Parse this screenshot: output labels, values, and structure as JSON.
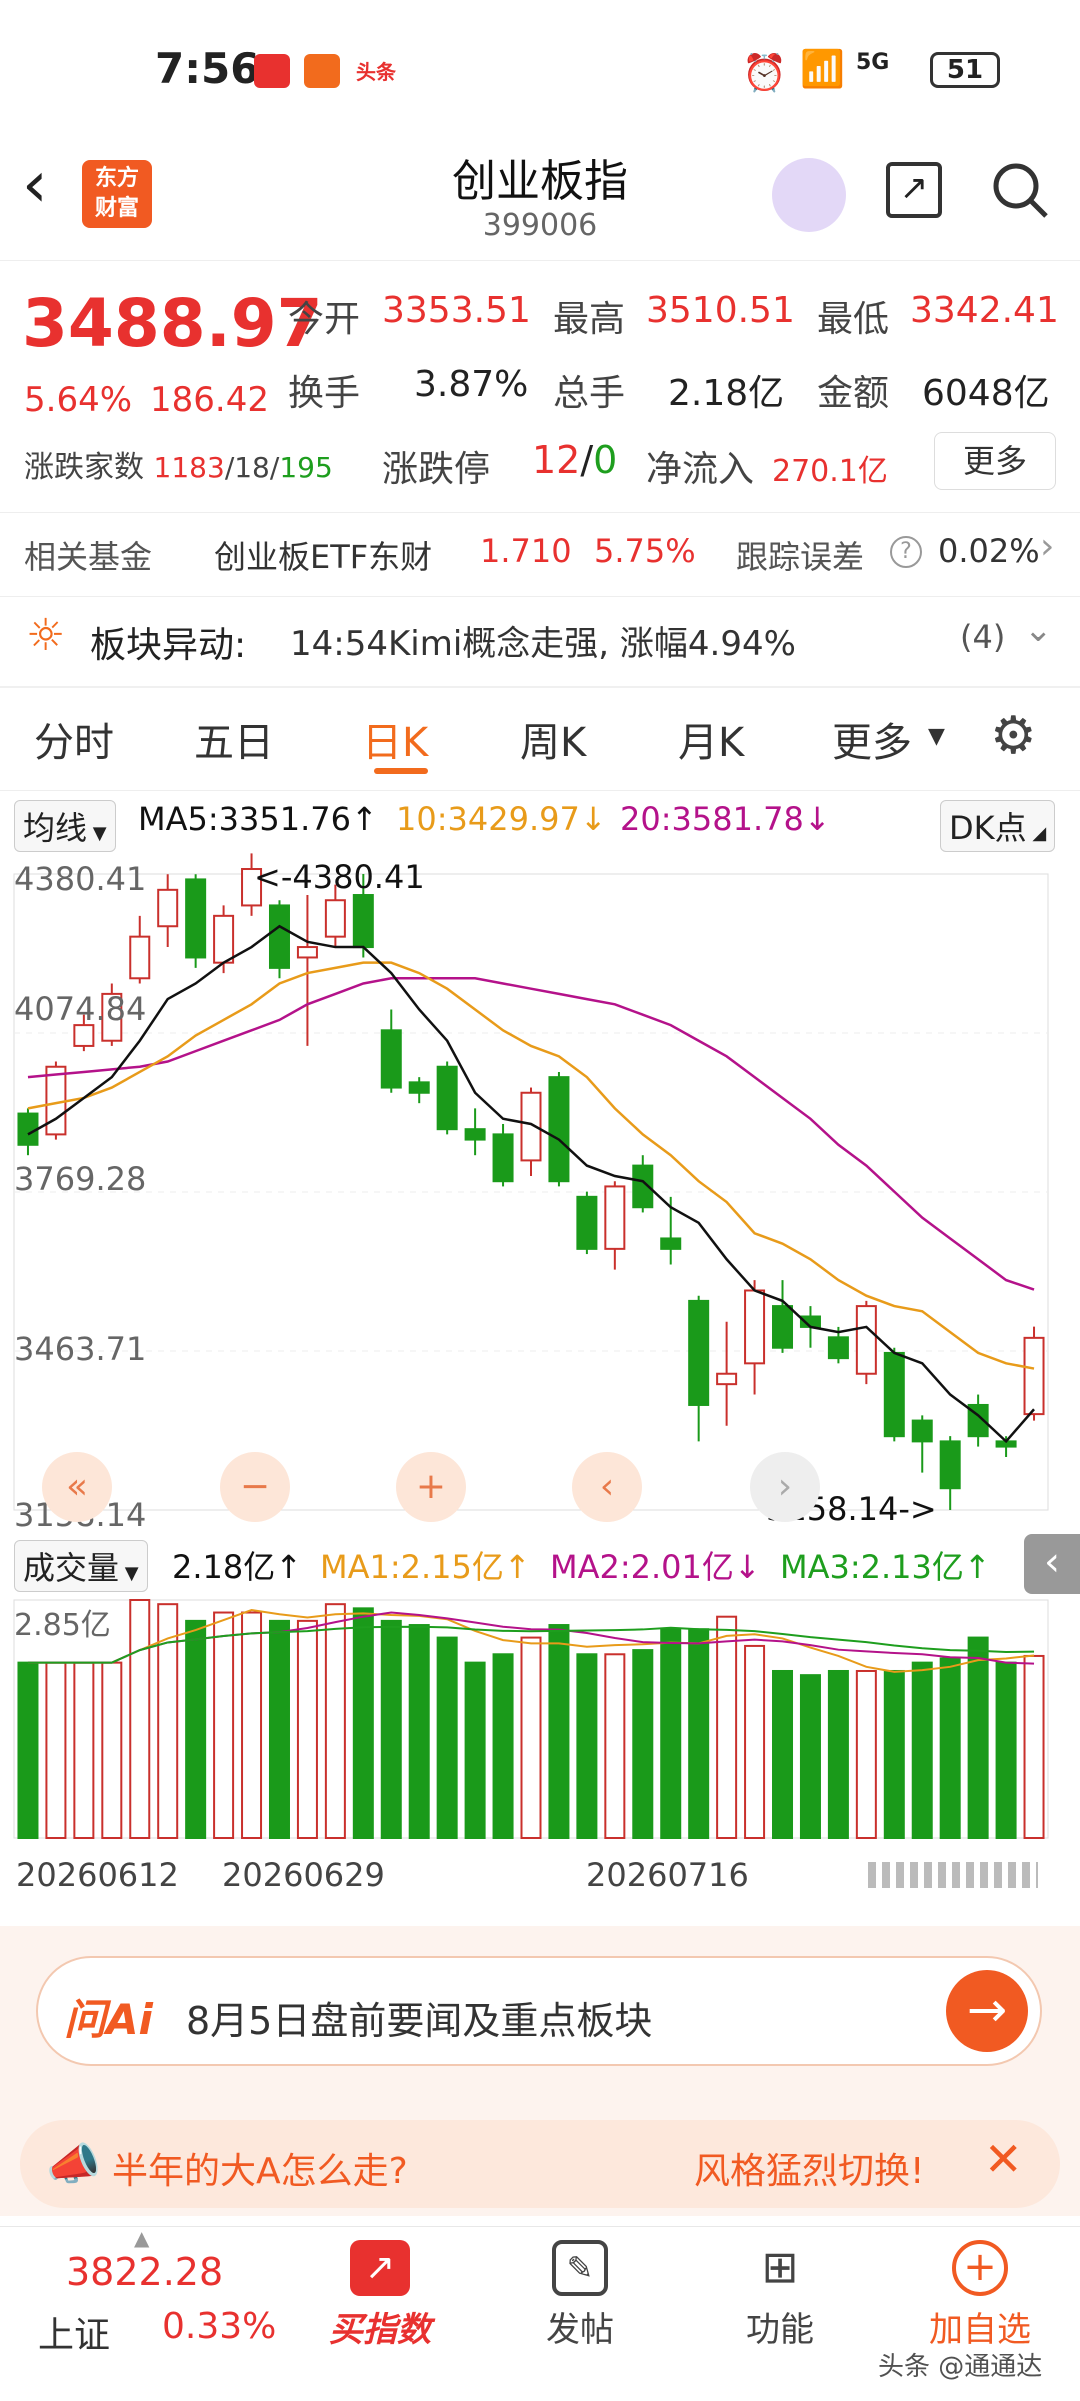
{
  "status_bar": {
    "time": "7:56",
    "notif_toutiao": "头条",
    "network": "5G",
    "battery": "51"
  },
  "header": {
    "logo_line1": "东方",
    "logo_line2": "财富",
    "title": "创业板指",
    "code": "399006"
  },
  "quote": {
    "price": "3488.97",
    "pct": "5.64%",
    "change": "186.42",
    "open_label": "今开",
    "open": "3353.51",
    "high_label": "最高",
    "high": "3510.51",
    "low_label": "最低",
    "low": "3342.41",
    "turnover_label": "换手",
    "turnover": "3.87%",
    "vol_label": "总手",
    "vol": "2.18亿",
    "amount_label": "金额",
    "amount": "6048亿",
    "breadth_label": "涨跌家数",
    "breadth_up": "1183",
    "breadth_flat": "/18/",
    "breadth_down": "195",
    "limit_label": "涨跌停",
    "limit_up": "12",
    "limit_sep": "/",
    "limit_down": "0",
    "netflow_label": "净流入",
    "netflow": "270.1亿",
    "more": "更多"
  },
  "fund": {
    "label": "相关基金",
    "name": "创业板ETF东财",
    "price": "1.710",
    "pct": "5.75%",
    "err_label": "跟踪误差",
    "err": "0.02%"
  },
  "alert": {
    "label": "板块异动:",
    "text": "14:54Kimi概念走强, 涨幅4.94%",
    "count": "(4)"
  },
  "tabs": [
    "分时",
    "五日",
    "日K",
    "周K",
    "月K",
    "更多"
  ],
  "ma": {
    "selector": "均线",
    "ma5": "MA5:3351.76↑",
    "ma10": "10:3429.97↓",
    "ma20": "20:3581.78↓",
    "dk": "DK点"
  },
  "price_axis": [
    "4380.41",
    "4074.84",
    "3769.28",
    "3463.71",
    "3158.14"
  ],
  "annotations": {
    "high": "<-4380.41",
    "low": "3158.14->"
  },
  "vol_header": {
    "selector": "成交量",
    "vol": "2.18亿↑",
    "ma1": "MA1:2.15亿↑",
    "ma2": "MA2:2.01亿↓",
    "ma3": "MA3:2.13亿↑",
    "axis_top": "2.85亿"
  },
  "date_axis": [
    "20260612",
    "20260629",
    "20260716"
  ],
  "ask": {
    "brand": "问Ai",
    "text": "8月5日盘前要闻及重点板块"
  },
  "notice": {
    "left": "半年的大A怎么走?",
    "right": "风格猛烈切换!"
  },
  "bottom_nav": {
    "index_value": "3822.28",
    "index_name": "上证",
    "index_pct": "0.33%",
    "buy": "买指数",
    "post": "发帖",
    "func": "功能",
    "watch": "加自选",
    "watermark": "头条 @通通达"
  },
  "chart_data": {
    "type": "candlestick",
    "ylim": [
      3158.14,
      4380.41
    ],
    "candles": [
      {
        "o": 3920,
        "c": 3860,
        "h": 3930,
        "l": 3840
      },
      {
        "o": 3880,
        "c": 4010,
        "h": 4020,
        "l": 3870
      },
      {
        "o": 4050,
        "c": 4090,
        "h": 4110,
        "l": 4040
      },
      {
        "o": 4060,
        "c": 4150,
        "h": 4170,
        "l": 4050
      },
      {
        "o": 4180,
        "c": 4260,
        "h": 4300,
        "l": 4170
      },
      {
        "o": 4280,
        "c": 4350,
        "h": 4380,
        "l": 4240
      },
      {
        "o": 4370,
        "c": 4220,
        "h": 4380,
        "l": 4200
      },
      {
        "o": 4210,
        "c": 4300,
        "h": 4320,
        "l": 4190
      },
      {
        "o": 4320,
        "c": 4390,
        "h": 4420,
        "l": 4300
      },
      {
        "o": 4320,
        "c": 4200,
        "h": 4330,
        "l": 4180
      },
      {
        "o": 4220,
        "c": 4240,
        "h": 4340,
        "l": 4050
      },
      {
        "o": 4260,
        "c": 4330,
        "h": 4360,
        "l": 4240
      },
      {
        "o": 4340,
        "c": 4240,
        "h": 4380.41,
        "l": 4220
      },
      {
        "o": 4080,
        "c": 3970,
        "h": 4120,
        "l": 3960
      },
      {
        "o": 3980,
        "c": 3960,
        "h": 3990,
        "l": 3940
      },
      {
        "o": 4010,
        "c": 3890,
        "h": 4020,
        "l": 3880
      },
      {
        "o": 3890,
        "c": 3870,
        "h": 3930,
        "l": 3840
      },
      {
        "o": 3880,
        "c": 3790,
        "h": 3900,
        "l": 3780
      },
      {
        "o": 3830,
        "c": 3960,
        "h": 3970,
        "l": 3800
      },
      {
        "o": 3990,
        "c": 3790,
        "h": 4000,
        "l": 3780
      },
      {
        "o": 3760,
        "c": 3660,
        "h": 3770,
        "l": 3650
      },
      {
        "o": 3660,
        "c": 3780,
        "h": 3790,
        "l": 3620
      },
      {
        "o": 3820,
        "c": 3740,
        "h": 3840,
        "l": 3730
      },
      {
        "o": 3680,
        "c": 3660,
        "h": 3760,
        "l": 3630
      },
      {
        "o": 3560,
        "c": 3360,
        "h": 3570,
        "l": 3290
      },
      {
        "o": 3400,
        "c": 3420,
        "h": 3520,
        "l": 3320
      },
      {
        "o": 3440,
        "c": 3580,
        "h": 3600,
        "l": 3380
      },
      {
        "o": 3550,
        "c": 3470,
        "h": 3600,
        "l": 3460
      },
      {
        "o": 3530,
        "c": 3510,
        "h": 3550,
        "l": 3470
      },
      {
        "o": 3490,
        "c": 3450,
        "h": 3510,
        "l": 3440
      },
      {
        "o": 3420,
        "c": 3550,
        "h": 3560,
        "l": 3400
      },
      {
        "o": 3460,
        "c": 3300,
        "h": 3470,
        "l": 3290
      },
      {
        "o": 3330,
        "c": 3290,
        "h": 3340,
        "l": 3230
      },
      {
        "o": 3290,
        "c": 3200,
        "h": 3300,
        "l": 3158.14
      },
      {
        "o": 3360,
        "c": 3300,
        "h": 3380,
        "l": 3280
      },
      {
        "o": 3290,
        "c": 3280,
        "h": 3300,
        "l": 3260
      },
      {
        "o": 3342.41,
        "c": 3488.97,
        "h": 3510.51,
        "l": 3330
      }
    ],
    "ma5": [
      3880,
      3910,
      3950,
      3990,
      4060,
      4140,
      4170,
      4210,
      4240,
      4280,
      4250,
      4240,
      4240,
      4190,
      4120,
      4060,
      3960,
      3910,
      3900,
      3870,
      3820,
      3800,
      3790,
      3740,
      3710,
      3640,
      3580,
      3560,
      3510,
      3500,
      3510,
      3460,
      3440,
      3380,
      3340,
      3290,
      3351.76
    ],
    "ma10": [
      3930,
      3940,
      3950,
      3970,
      4000,
      4030,
      4070,
      4100,
      4130,
      4170,
      4190,
      4200,
      4210,
      4210,
      4190,
      4160,
      4120,
      4080,
      4050,
      4030,
      3990,
      3930,
      3880,
      3840,
      3790,
      3750,
      3690,
      3670,
      3640,
      3600,
      3570,
      3550,
      3540,
      3500,
      3460,
      3440,
      3429.97
    ],
    "ma20": [
      3990,
      3995,
      4000,
      4005,
      4010,
      4020,
      4040,
      4060,
      4080,
      4100,
      4130,
      4150,
      4170,
      4180,
      4180,
      4180,
      4180,
      4170,
      4160,
      4150,
      4140,
      4130,
      4110,
      4090,
      4060,
      4030,
      3990,
      3950,
      3910,
      3860,
      3820,
      3770,
      3720,
      3680,
      3640,
      3600,
      3581.78
    ],
    "volume": [
      2.1,
      2.1,
      2.1,
      2.1,
      2.85,
      2.8,
      2.6,
      2.7,
      2.7,
      2.6,
      2.6,
      2.8,
      2.75,
      2.6,
      2.55,
      2.4,
      2.1,
      2.2,
      2.4,
      2.55,
      2.2,
      2.2,
      2.25,
      2.5,
      2.5,
      2.65,
      2.3,
      2.0,
      1.95,
      2.0,
      2.0,
      2.0,
      2.1,
      2.15,
      2.4,
      2.1,
      2.18
    ],
    "vol_ylim": [
      0,
      2.85
    ]
  }
}
